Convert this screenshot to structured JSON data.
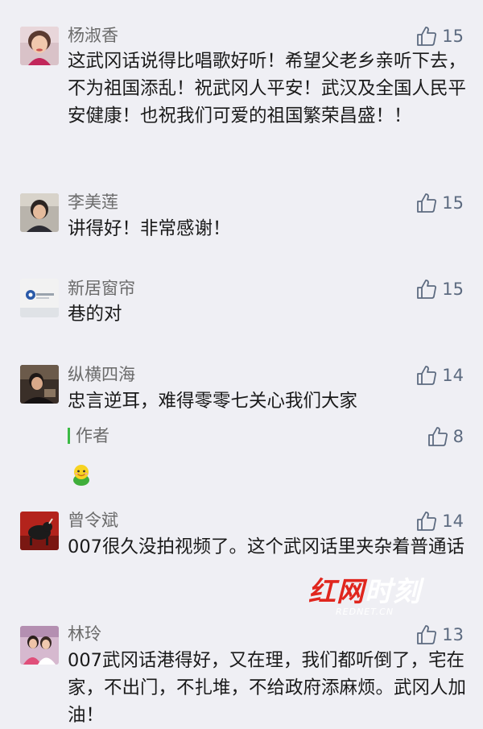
{
  "comments": [
    {
      "name": "杨淑香",
      "likes": "15",
      "text": "这武冈话说得比唱歌好听！希望父老乡亲听下去，不为祖国添乱！祝武冈人平安！武汉及全国人民平安健康！也祝我们可爱的祖国繁荣昌盛！！"
    },
    {
      "name": "李美莲",
      "likes": "15",
      "text": "讲得好！非常感谢！"
    },
    {
      "name": "新居窗帘",
      "likes": "15",
      "text": "巷的对"
    },
    {
      "name": "纵横四海",
      "likes": "14",
      "text": "忠言逆耳，难得零零七关心我们大家",
      "reply": {
        "label": "作者",
        "likes": "8",
        "emoji": "smiling-chick-emoji"
      }
    },
    {
      "name": "曾令斌",
      "likes": "14",
      "text": "007很久没拍视频了。这个武冈话里夹杂着普通话"
    },
    {
      "name": "林玲",
      "likes": "13",
      "text": "007武冈话港得好，又在理，我们都听倒了，宅在家，不出门，不扎堆，不给政府添麻烦。武冈人加油！"
    }
  ],
  "watermark": {
    "main_red": "红网",
    "main_white": "时刻",
    "sub": "REDNET.CN"
  },
  "colors": {
    "background": "#efeff4",
    "name": "#6b6b6b",
    "likes": "#5d6b80",
    "author_bar": "#3cba45",
    "watermark_red": "#e0261e"
  },
  "icons": {
    "like": "thumbs-up-icon"
  }
}
